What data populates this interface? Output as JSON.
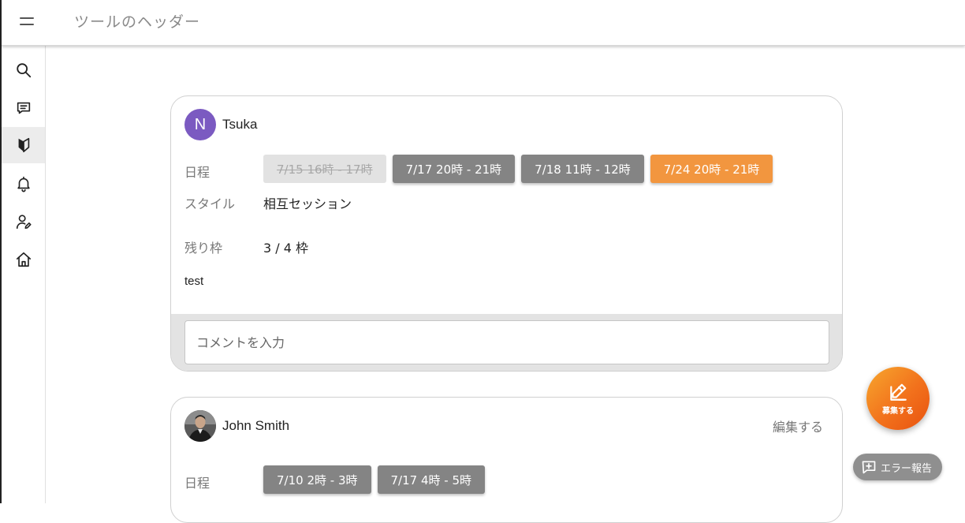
{
  "header": {
    "title": "ツールのヘッダー"
  },
  "sidebar": {
    "items": [
      {
        "icon": "search-icon"
      },
      {
        "icon": "chat-icon"
      },
      {
        "icon": "beginner-mark-icon",
        "active": true
      },
      {
        "icon": "bell-icon"
      },
      {
        "icon": "user-edit-icon"
      },
      {
        "icon": "home-icon"
      }
    ]
  },
  "posts": [
    {
      "avatar_initial": "N",
      "author": "Tsuka",
      "schedule_label": "日程",
      "schedule": [
        {
          "text": "7/15 16時 - 17時",
          "state": "disabled"
        },
        {
          "text": "7/17 20時 - 21時",
          "state": "available"
        },
        {
          "text": "7/18 11時 - 12時",
          "state": "available"
        },
        {
          "text": "7/24 20時 - 21時",
          "state": "selected"
        }
      ],
      "style_label": "スタイル",
      "style_value": "相互セッション",
      "slots_label": "残り枠",
      "slots_value": "3 / 4 枠",
      "body": "test",
      "comment_placeholder": "コメントを入力"
    },
    {
      "author": "John Smith",
      "edit_label": "編集する",
      "schedule_label": "日程",
      "schedule": [
        {
          "text": "7/10 2時 - 3時",
          "state": "available"
        },
        {
          "text": "7/17 4時 - 5時",
          "state": "available"
        }
      ]
    }
  ],
  "fab": {
    "label": "募集する",
    "icon": "pencil-icon"
  },
  "report": {
    "label": "エラー報告",
    "icon": "report-icon"
  },
  "colors": {
    "accent": "#f2963f",
    "chip_grey": "#848484",
    "avatar": "#7b5ac1"
  }
}
